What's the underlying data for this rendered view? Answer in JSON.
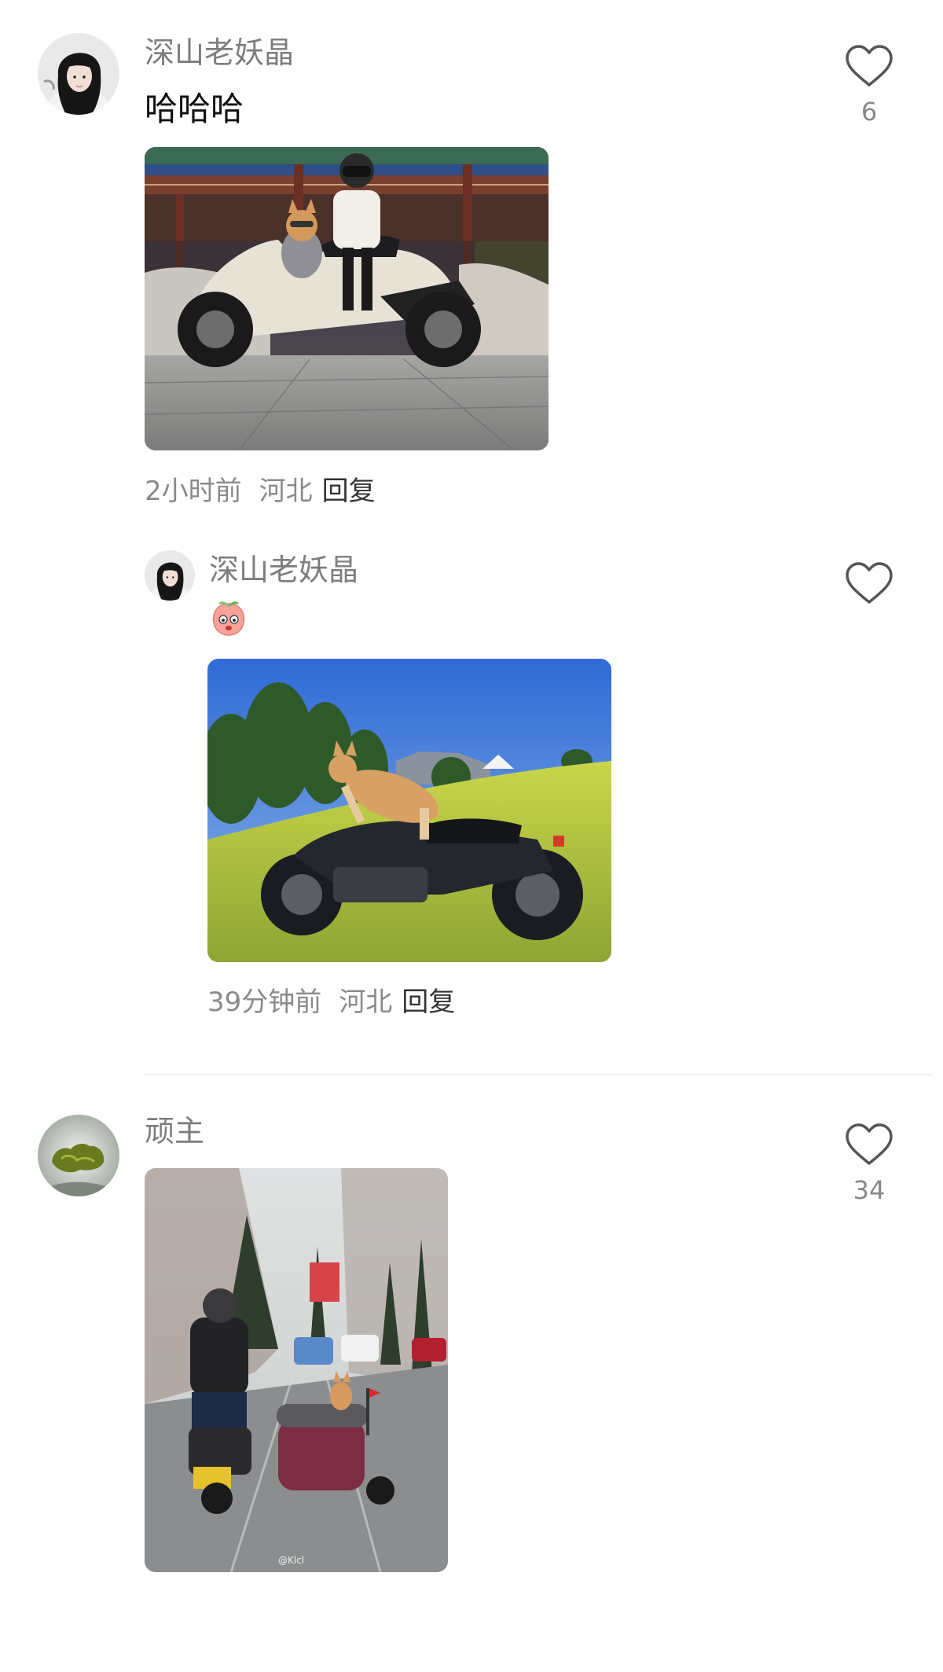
{
  "comments": [
    {
      "username": "深山老妖晶",
      "text": "哈哈哈",
      "time": "2小时前",
      "location": "河北",
      "reply_label": "回复",
      "likes": "6",
      "image_caption": "",
      "replies": [
        {
          "username": "深山老妖晶",
          "sticker_icon": "peach-face-emoji",
          "time": "39分钟前",
          "location": "河北",
          "reply_label": "回复",
          "likes": ""
        }
      ]
    },
    {
      "username": "顽主",
      "likes": "34",
      "image_watermark": "@Klcl"
    }
  ],
  "colors": {
    "username": "#7d7d7d",
    "meta": "#8a8a8a",
    "reply": "#333333",
    "heart": "#555555"
  }
}
